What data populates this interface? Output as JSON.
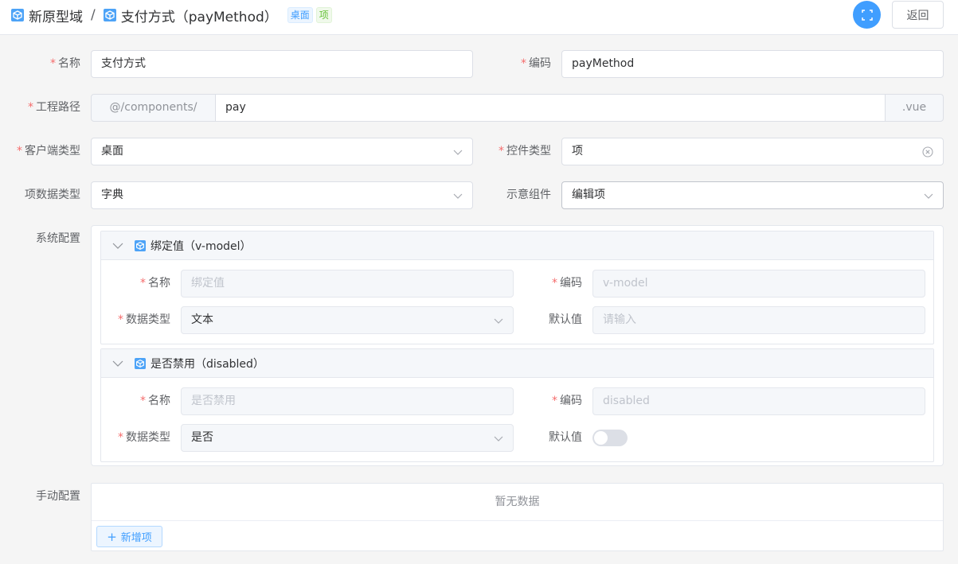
{
  "header": {
    "domain": "新原型域",
    "separator": "/",
    "title": "支付方式（payMethod）",
    "tag_client": "桌面",
    "tag_type": "项",
    "back_label": "返回"
  },
  "form": {
    "name_label": "名称",
    "name_value": "支付方式",
    "code_label": "编码",
    "code_value": "payMethod",
    "path_label": "工程路径",
    "path_prefix": "@/components/",
    "path_value": "pay",
    "path_suffix": ".vue",
    "client_label": "客户端类型",
    "client_value": "桌面",
    "control_label": "控件类型",
    "control_value": "项",
    "item_data_label": "项数据类型",
    "item_data_value": "字典",
    "demo_label": "示意组件",
    "demo_value": "编辑项",
    "system_label": "系统配置",
    "manual_label": "手动配置"
  },
  "system_config": [
    {
      "title": "绑定值（v-model）",
      "name_label": "名称",
      "name_value": "绑定值",
      "code_label": "编码",
      "code_value": "v-model",
      "type_label": "数据类型",
      "type_value": "文本",
      "default_label": "默认值",
      "default_placeholder": "请输入"
    },
    {
      "title": "是否禁用（disabled）",
      "name_label": "名称",
      "name_value": "是否禁用",
      "code_label": "编码",
      "code_value": "disabled",
      "type_label": "数据类型",
      "type_value": "是否",
      "default_label": "默认值",
      "default_switch_on": false
    }
  ],
  "manual_config": {
    "empty_text": "暂无数据",
    "add_label": "新增项",
    "add_icon": "+"
  },
  "colors": {
    "primary": "#409eff",
    "required": "#f56c6c"
  }
}
